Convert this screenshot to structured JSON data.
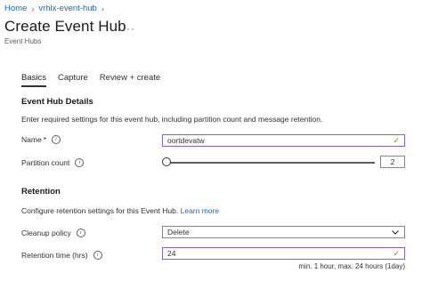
{
  "breadcrumb": {
    "items": [
      "Home",
      "vrhlx-event-hub"
    ]
  },
  "page": {
    "title": "Create Event Hub",
    "subtitle": "Event Hubs",
    "more": "···"
  },
  "tabs": [
    {
      "label": "Basics",
      "active": true
    },
    {
      "label": "Capture",
      "active": false
    },
    {
      "label": "Review + create",
      "active": false
    }
  ],
  "details": {
    "heading": "Event Hub Details",
    "description": "Enter required settings for this event hub, including partition count and message retention.",
    "name_label": "Name",
    "name_required": "*",
    "name_value": "oortdevatw",
    "partition_label": "Partition count",
    "partition_value": "2"
  },
  "retention": {
    "heading": "Retention",
    "description": "Configure retention settings for this Event Hub.",
    "learn_more": "Learn more",
    "cleanup_label": "Cleanup policy",
    "cleanup_value": "Delete",
    "time_label": "Retention time (hrs)",
    "time_value": "24",
    "time_hint": "min. 1 hour, max. 24 hours (1day)"
  },
  "icons": {
    "info": "info-icon",
    "check": "checkmark-icon",
    "dropdown": "chevron-down-icon"
  }
}
